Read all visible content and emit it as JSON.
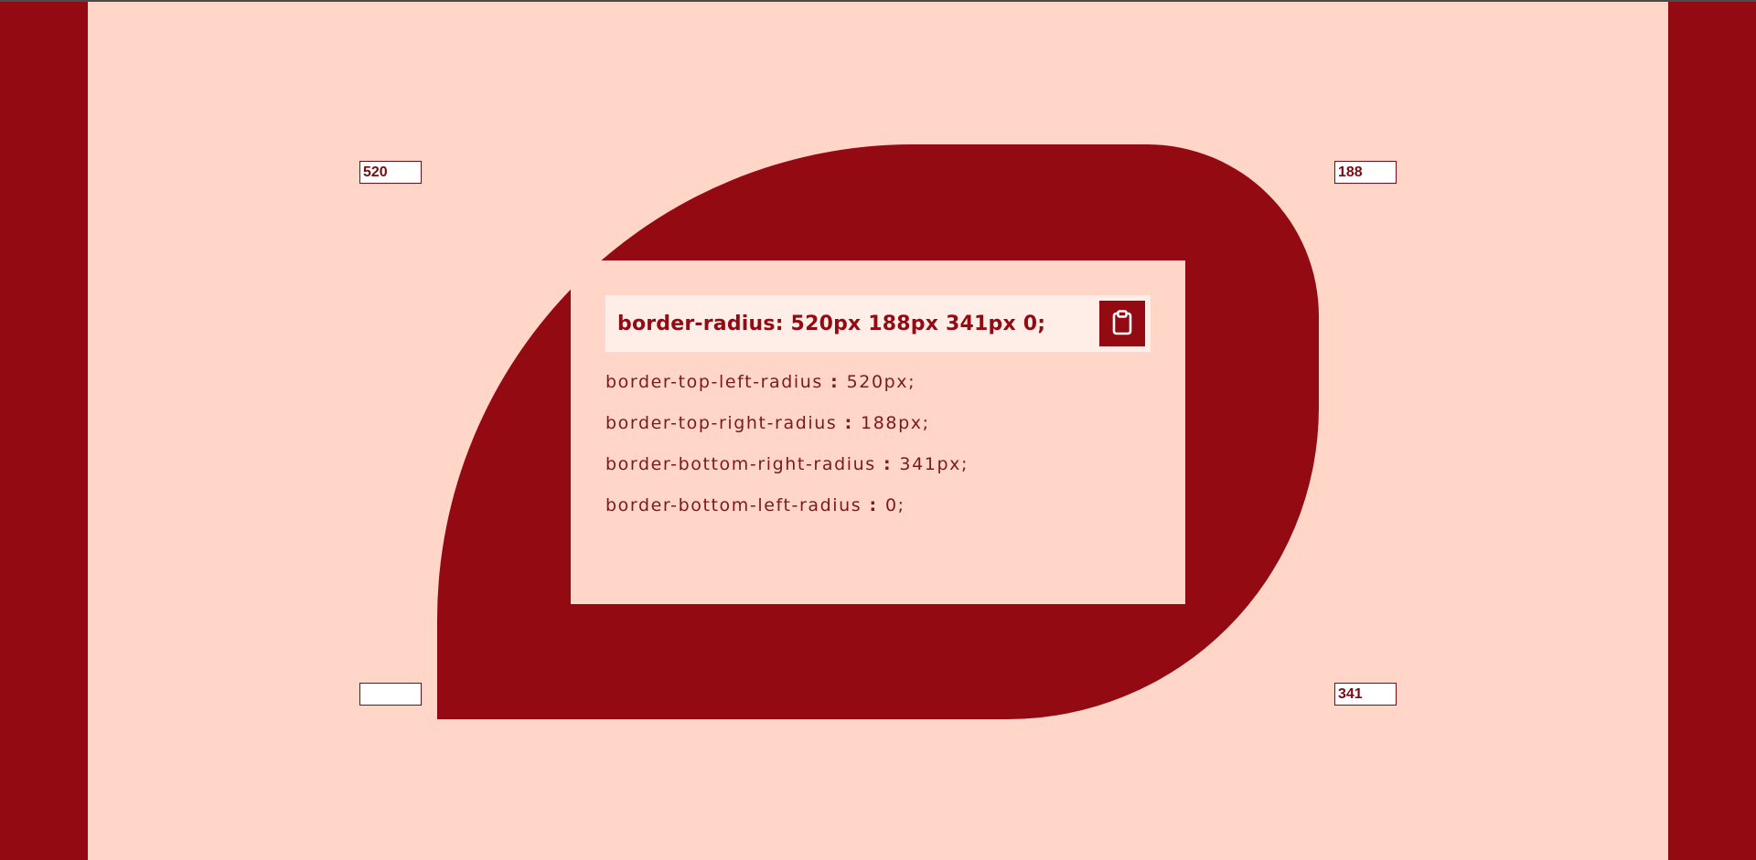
{
  "corners": {
    "top_left": {
      "value": "520"
    },
    "top_right": {
      "value": "188"
    },
    "bottom_right": {
      "value": "341"
    },
    "bottom_left": {
      "value": ""
    }
  },
  "card": {
    "code": "border-radius: 520px 188px 341px 0;",
    "copy_icon": "clipboard-icon",
    "properties": [
      {
        "name": "border-top-left-radius",
        "sep": " : ",
        "value": "520px;"
      },
      {
        "name": "border-top-right-radius",
        "sep": " : ",
        "value": "188px;"
      },
      {
        "name": "border-bottom-right-radius",
        "sep": " : ",
        "value": "341px;"
      },
      {
        "name": "border-bottom-left-radius",
        "sep": " : ",
        "value": "0;"
      }
    ]
  },
  "colors": {
    "accent": "#940a13",
    "background": "#ffd6c8",
    "code_bg": "#ffeee8"
  }
}
